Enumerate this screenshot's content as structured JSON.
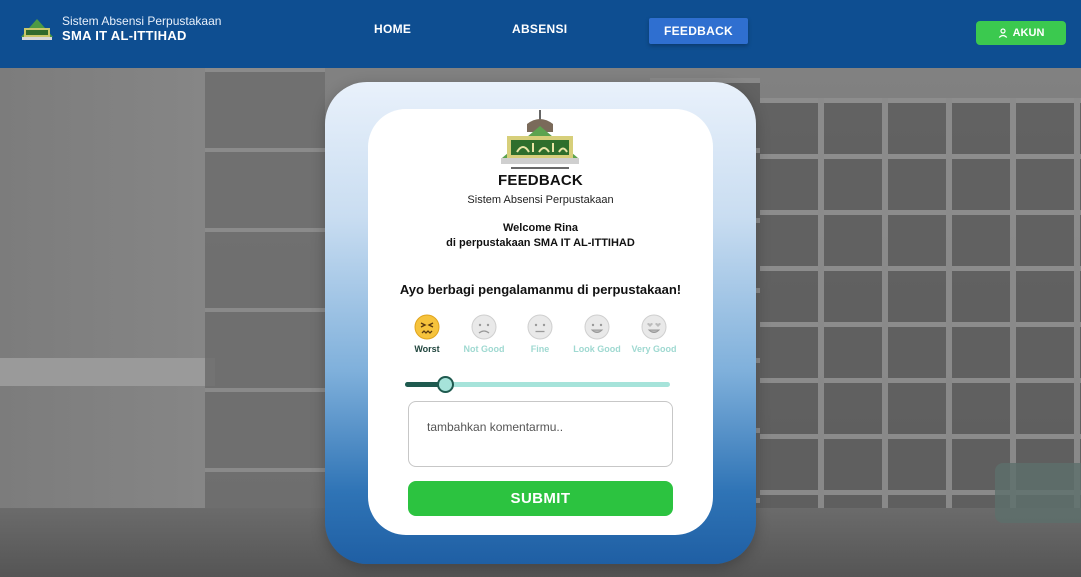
{
  "navbar": {
    "app_subtitle": "Sistem Absensi Perpustakaan",
    "school_name": "SMA IT AL-ITTIHAD",
    "links": [
      {
        "label": "HOME"
      },
      {
        "label": "ABSENSI"
      },
      {
        "label": "FEEDBACK",
        "active": true
      }
    ],
    "account_button": {
      "label": "AKUN",
      "icon": "user-icon"
    },
    "colors": {
      "background": "#0e4e91",
      "active_link": "#2f6fd0",
      "account": "#3bc94f"
    }
  },
  "card": {
    "title": "FEEDBACK",
    "subtitle": "Sistem Absensi Perpustakaan",
    "welcome_line1": "Welcome Rina",
    "welcome_line2": "di perpustakaan SMA IT AL-ITTIHAD",
    "question": "Ayo berbagi pengalamanmu di perpustakaan!",
    "ratings": [
      {
        "label": "Worst",
        "icon": "confounded-face-icon",
        "selected": true
      },
      {
        "label": "Not Good",
        "icon": "frowning-face-icon",
        "selected": false
      },
      {
        "label": "Fine",
        "icon": "neutral-face-icon",
        "selected": false
      },
      {
        "label": "Look Good",
        "icon": "smiling-face-icon",
        "selected": false
      },
      {
        "label": "Very Good",
        "icon": "heart-eyes-face-icon",
        "selected": false
      }
    ],
    "slider_value_fraction": 0.13,
    "comment_placeholder": "tambahkan komentarmu..",
    "submit_label": "SUBMIT",
    "colors": {
      "submit": "#2cc340",
      "slider_active": "#1f5a4f",
      "slider_track": "#a6e3da"
    }
  }
}
